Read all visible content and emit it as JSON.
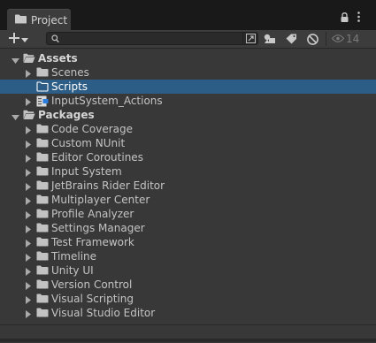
{
  "tab": {
    "title": "Project"
  },
  "toolbar": {
    "create_icon": "plus-icon",
    "search": {
      "value": "",
      "placeholder": ""
    },
    "hidden_count": "14"
  },
  "colors": {
    "panel_bg": "#383838",
    "selection": "#2c5d87",
    "text": "#c4c4c4",
    "folder_fill": "#c2c2c2"
  },
  "tree": {
    "rows": [
      {
        "label": "Assets",
        "expanded": true,
        "selected": false,
        "bold": true,
        "level": 0,
        "icon": "folder-open-icon"
      },
      {
        "label": "Scenes",
        "expanded": false,
        "selected": false,
        "bold": false,
        "level": 1,
        "icon": "folder-icon"
      },
      {
        "label": "Scripts",
        "expanded": null,
        "selected": true,
        "bold": false,
        "level": 1,
        "icon": "folder-empty-icon"
      },
      {
        "label": "InputSystem_Actions",
        "expanded": false,
        "selected": false,
        "bold": false,
        "level": 1,
        "icon": "input-actions-icon"
      },
      {
        "label": "Packages",
        "expanded": true,
        "selected": false,
        "bold": true,
        "level": 0,
        "icon": "folder-open-icon"
      },
      {
        "label": "Code Coverage",
        "expanded": false,
        "selected": false,
        "bold": false,
        "level": 1,
        "icon": "folder-icon"
      },
      {
        "label": "Custom NUnit",
        "expanded": false,
        "selected": false,
        "bold": false,
        "level": 1,
        "icon": "folder-icon"
      },
      {
        "label": "Editor Coroutines",
        "expanded": false,
        "selected": false,
        "bold": false,
        "level": 1,
        "icon": "folder-icon"
      },
      {
        "label": "Input System",
        "expanded": false,
        "selected": false,
        "bold": false,
        "level": 1,
        "icon": "folder-icon"
      },
      {
        "label": "JetBrains Rider Editor",
        "expanded": false,
        "selected": false,
        "bold": false,
        "level": 1,
        "icon": "folder-icon"
      },
      {
        "label": "Multiplayer Center",
        "expanded": false,
        "selected": false,
        "bold": false,
        "level": 1,
        "icon": "folder-icon"
      },
      {
        "label": "Profile Analyzer",
        "expanded": false,
        "selected": false,
        "bold": false,
        "level": 1,
        "icon": "folder-icon"
      },
      {
        "label": "Settings Manager",
        "expanded": false,
        "selected": false,
        "bold": false,
        "level": 1,
        "icon": "folder-icon"
      },
      {
        "label": "Test Framework",
        "expanded": false,
        "selected": false,
        "bold": false,
        "level": 1,
        "icon": "folder-icon"
      },
      {
        "label": "Timeline",
        "expanded": false,
        "selected": false,
        "bold": false,
        "level": 1,
        "icon": "folder-icon"
      },
      {
        "label": "Unity UI",
        "expanded": false,
        "selected": false,
        "bold": false,
        "level": 1,
        "icon": "folder-icon"
      },
      {
        "label": "Version Control",
        "expanded": false,
        "selected": false,
        "bold": false,
        "level": 1,
        "icon": "folder-icon"
      },
      {
        "label": "Visual Scripting",
        "expanded": false,
        "selected": false,
        "bold": false,
        "level": 1,
        "icon": "folder-icon"
      },
      {
        "label": "Visual Studio Editor",
        "expanded": false,
        "selected": false,
        "bold": false,
        "level": 1,
        "icon": "folder-icon"
      }
    ]
  }
}
